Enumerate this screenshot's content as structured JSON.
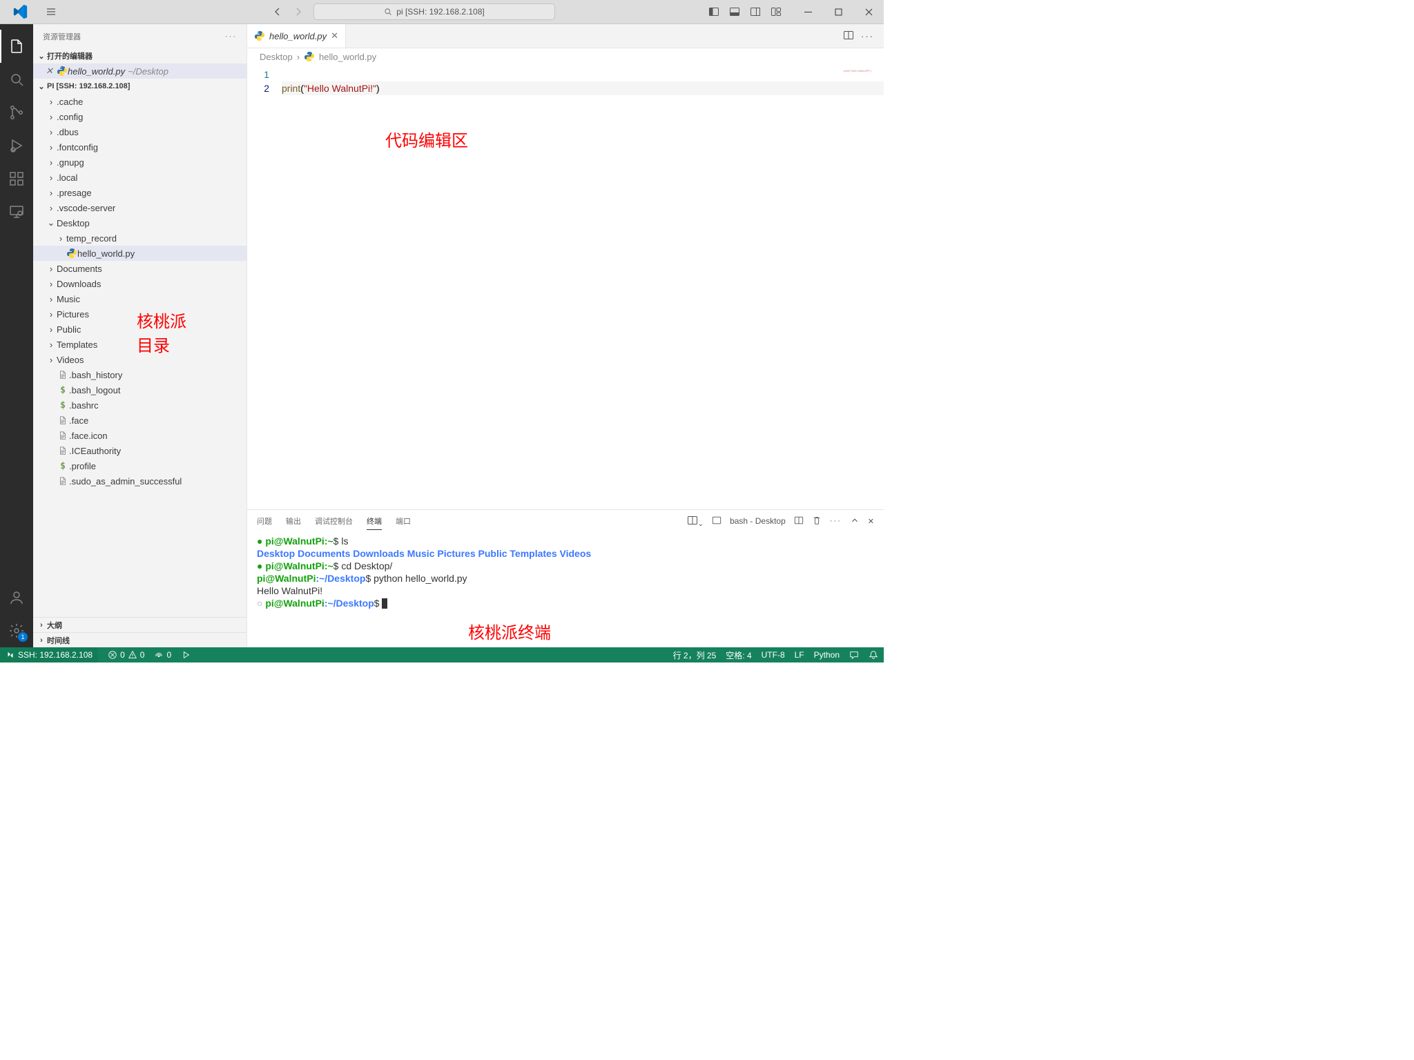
{
  "titlebar": {
    "search_prefix": "pi [SSH: 192.168.2.108]"
  },
  "activity_badge": "1",
  "sidebar": {
    "title": "资源管理器",
    "open_editors_label": "打开的编辑器",
    "open_editor": {
      "name": "hello_world.py",
      "path": "~/Desktop"
    },
    "workspace_label": "PI [SSH: 192.168.2.108]",
    "folders_top": [
      ".cache",
      ".config",
      ".dbus",
      ".fontconfig",
      ".gnupg",
      ".local",
      ".presage",
      ".vscode-server"
    ],
    "desktop": "Desktop",
    "desktop_children": {
      "folder": "temp_record",
      "file": "hello_world.py"
    },
    "folders_mid": [
      "Documents",
      "Downloads",
      "Music",
      "Pictures",
      "Public",
      "Templates",
      "Videos"
    ],
    "files": [
      {
        "name": ".bash_history",
        "icon": "file"
      },
      {
        "name": ".bash_logout",
        "icon": "dollar"
      },
      {
        "name": ".bashrc",
        "icon": "dollar"
      },
      {
        "name": ".face",
        "icon": "file"
      },
      {
        "name": ".face.icon",
        "icon": "file"
      },
      {
        "name": ".ICEauthority",
        "icon": "file"
      },
      {
        "name": ".profile",
        "icon": "dollar"
      },
      {
        "name": ".sudo_as_admin_successful",
        "icon": "file"
      }
    ],
    "outline_label": "大纲",
    "timeline_label": "时间线"
  },
  "tab": {
    "name": "hello_world.py"
  },
  "breadcrumb": {
    "seg0": "Desktop",
    "seg1": "hello_world.py"
  },
  "code": {
    "l1": "1",
    "l2": "2",
    "print": "print",
    "lp": "(",
    "str": "\"Hello WalnutPi!\"",
    "rp": ")"
  },
  "annotations": {
    "editor": "代码编辑区",
    "tree1": "核桃派",
    "tree2": "目录",
    "terminal": "核桃派终端"
  },
  "panel": {
    "tabs": {
      "problems": "问题",
      "output": "输出",
      "debug": "调试控制台",
      "terminal": "终端",
      "ports": "端口"
    },
    "term_name": "bash - Desktop"
  },
  "terminal": {
    "prompt1_user": "pi@WalnutPi",
    "prompt1_path": ":~",
    "prompt1_sym": "$ ",
    "cmd1": "ls",
    "dirs": "Desktop   Documents   Downloads   Music   Pictures   Public   Templates   Videos",
    "prompt2_user": "pi@WalnutPi",
    "prompt2_path": ":~",
    "prompt2_sym": "$ ",
    "cmd2": "cd Desktop/",
    "prompt3_user": "pi@WalnutPi",
    "prompt3_path": ":~/Desktop",
    "prompt3_sym": "$ ",
    "cmd3": "python hello_world.py",
    "output": "Hello WalnutPi!",
    "prompt4_user": "pi@WalnutPi",
    "prompt4_path": ":~/Desktop",
    "prompt4_sym": "$ "
  },
  "status": {
    "ssh": "SSH: 192.168.2.108",
    "err": "0",
    "warn": "0",
    "ports": "0",
    "cursor": "行 2，列 25",
    "spaces": "空格: 4",
    "enc": "UTF-8",
    "eol": "LF",
    "lang": "Python"
  }
}
